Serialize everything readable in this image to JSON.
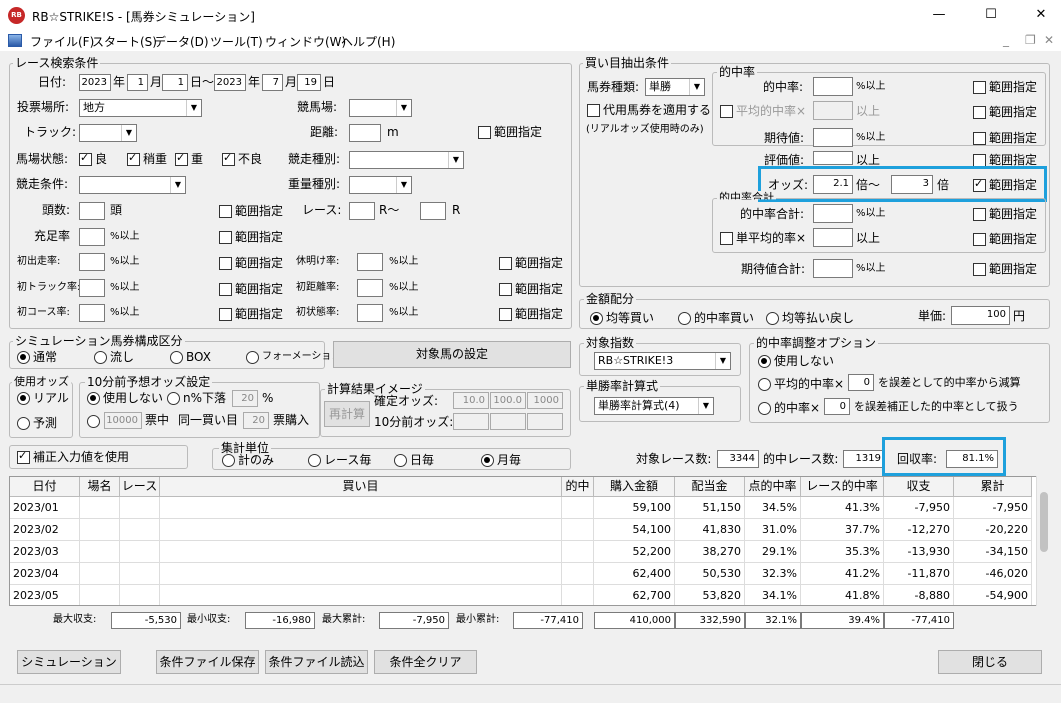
{
  "window": {
    "title": "RB☆STRIKE!S - [馬券シミュレーション]",
    "logo": "RB"
  },
  "menu": [
    "ファイル(F)",
    "スタート(S)",
    "データ(D)",
    "ツール(T)",
    "ウィンドウ(W)",
    "ヘルプ(H)"
  ],
  "race": {
    "group": "レース検索条件",
    "date_label": "日付:",
    "year1": "2023",
    "y": "年",
    "month1": "1",
    "m": "月",
    "day1": "1",
    "d_sep": "日〜",
    "year2": "2023",
    "month2": "7",
    "day2": "19",
    "d": "日",
    "venue_label": "投票場所:",
    "venue": "地方",
    "track_label": "競馬場:",
    "trk_label": "トラック:",
    "dist_label": "距離:",
    "unit_m": "m",
    "range": "範囲指定",
    "cond_label": "馬場状態:",
    "cond": [
      "良",
      "稍重",
      "重",
      "不良"
    ],
    "type_label": "競走種別:",
    "jyoken_label": "競走条件:",
    "weight_label": "重量種別:",
    "heads_label": "頭数:",
    "tou": "頭",
    "race_label": "レース:",
    "rsep": "R〜",
    "r": "R",
    "fill_label": "充足率",
    "pct_over": "%以上",
    "left_rows": [
      "初出走率:",
      "初トラック率:",
      "初コース率:"
    ],
    "right_rows": [
      "休明け率:",
      "初距離率:",
      "初状態率:"
    ]
  },
  "sim": {
    "group": "シミュレーション馬券構成区分",
    "opts": [
      "通常",
      "流し",
      "BOX",
      "フォーメーション"
    ],
    "btn": "対象馬の設定"
  },
  "odds_use": {
    "group": "使用オッズ",
    "opts": [
      "リアル",
      "予測"
    ]
  },
  "pre10": {
    "group": "10分前予想オッズ設定",
    "opt1": "使用しない",
    "opt2": "n%下落",
    "n": "20",
    "pct": "%",
    "v1": "10000",
    "t1": "票中",
    "t2": "同一買い目",
    "v2": "20",
    "t3": "票購入"
  },
  "calc": {
    "group": "計算結果イメージ",
    "btn": "再計算",
    "l1": "確定オッズ:",
    "a": "10.0",
    "b": "100.0",
    "c": "1000",
    "l2": "10分前オッズ:"
  },
  "adj": {
    "label": "補正入力値を使用"
  },
  "agg": {
    "group": "集計単位",
    "opts": [
      "計のみ",
      "レース毎",
      "日毎",
      "月毎"
    ]
  },
  "buy": {
    "group": "買い目抽出条件",
    "kind_label": "馬券種類:",
    "kind": "単勝",
    "subst": "代用馬券を適用する",
    "note": "(リアルオッズ使用時のみ)"
  },
  "hit": {
    "group": "的中率",
    "rows": [
      {
        "label": "的中率:",
        "val": "",
        "unit": "%以上"
      },
      {
        "label": "平均的中率×",
        "val": "",
        "unit": "以上"
      },
      {
        "label": "期待値:",
        "val": "",
        "unit": "%以上"
      },
      {
        "label": "評価値:",
        "val": "",
        "unit": "以上"
      }
    ],
    "odds_label": "オッズ:",
    "odds_from": "2.1",
    "odds_sep": "倍〜",
    "odds_to": "3",
    "odds_unit": "倍",
    "range": "範囲指定",
    "sub_group": "的中率合計",
    "sub_rows": [
      {
        "label": "的中率合計:",
        "unit": "%以上"
      },
      {
        "label": "単平均的率×",
        "unit": "以上"
      }
    ],
    "exp_label": "期待値合計:",
    "exp_unit": "%以上"
  },
  "money": {
    "group": "金額配分",
    "opts": [
      "均等買い",
      "的中率買い",
      "均等払い戻し"
    ],
    "unit_label": "単価:",
    "unit_val": "100",
    "yen": "円"
  },
  "target": {
    "group": "対象指数",
    "val": "RB☆STRIKE!3"
  },
  "win": {
    "group": "単勝率計算式",
    "val": "単勝率計算式(4)"
  },
  "hitopt": {
    "group": "的中率調整オプション",
    "o1": "使用しない",
    "o2a": "平均的中率×",
    "o2v": "0",
    "o2b": "を誤差として的中率から減算",
    "o3a": "的中率×",
    "o3v": "0",
    "o3b": "を誤差補正した的中率として扱う"
  },
  "stats": {
    "l1": "対象レース数:",
    "v1": "3344",
    "l2": "的中レース数:",
    "v2": "1319",
    "l3": "回収率:",
    "v3": "81.1%"
  },
  "table": {
    "headers": [
      "日付",
      "場名",
      "レース",
      "買い目",
      "的中",
      "購入金額",
      "配当金",
      "点的中率",
      "レース的中率",
      "収支",
      "累計"
    ],
    "rows": [
      [
        "2023/01",
        "",
        "",
        "",
        "",
        "59,100",
        "51,150",
        "34.5%",
        "41.3%",
        "-7,950",
        "-7,950"
      ],
      [
        "2023/02",
        "",
        "",
        "",
        "",
        "54,100",
        "41,830",
        "31.0%",
        "37.7%",
        "-12,270",
        "-20,220"
      ],
      [
        "2023/03",
        "",
        "",
        "",
        "",
        "52,200",
        "38,270",
        "29.1%",
        "35.3%",
        "-13,930",
        "-34,150"
      ],
      [
        "2023/04",
        "",
        "",
        "",
        "",
        "62,400",
        "50,530",
        "32.3%",
        "41.2%",
        "-11,870",
        "-46,020"
      ],
      [
        "2023/05",
        "",
        "",
        "",
        "",
        "62,700",
        "53,820",
        "34.1%",
        "41.8%",
        "-8,880",
        "-54,900"
      ]
    ]
  },
  "summary": {
    "l1": "最大収支:",
    "v1": "-5,530",
    "l2": "最小収支:",
    "v2": "-16,980",
    "l3": "最大累計:",
    "v3": "-7,950",
    "l4": "最小累計:",
    "v4": "-77,410",
    "t1": "410,000",
    "t2": "332,590",
    "t3": "32.1%",
    "t4": "39.4%",
    "t5": "-77,410"
  },
  "buttons": {
    "sim": "シミュレーション",
    "save": "条件ファイル保存",
    "load": "条件ファイル読込",
    "clear": "条件全クリア",
    "close": "閉じる"
  }
}
